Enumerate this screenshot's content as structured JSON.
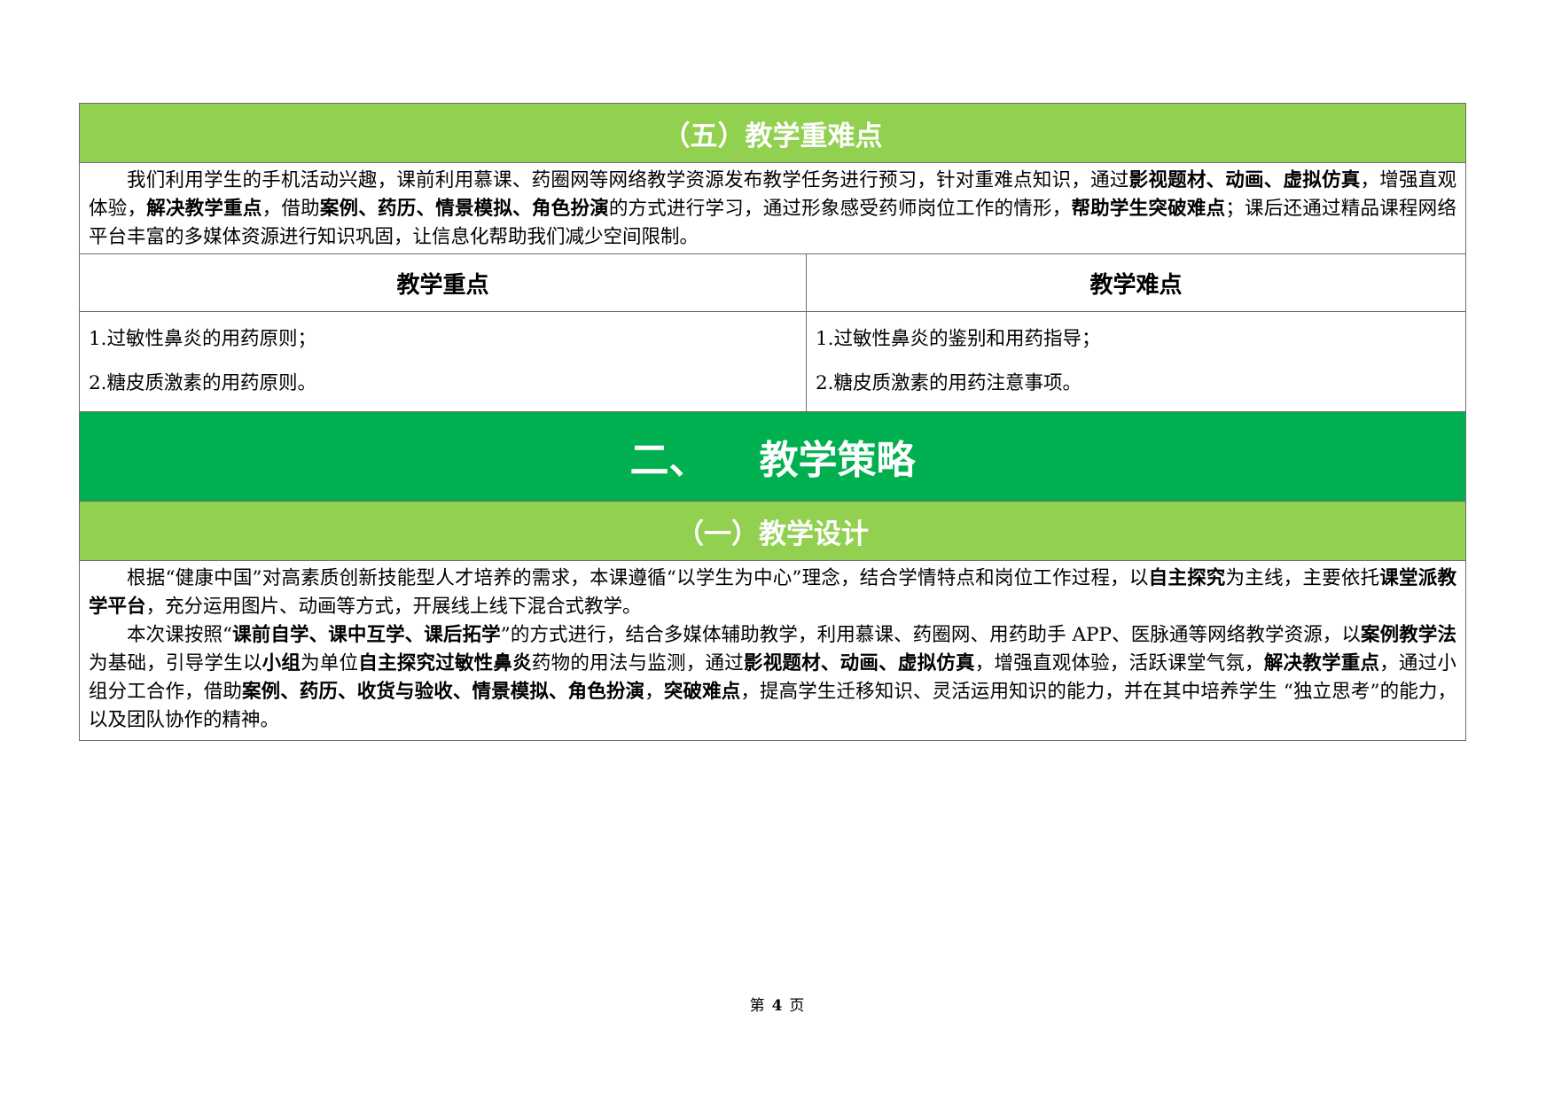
{
  "section5": {
    "title": "（五）教学重难点",
    "intro_runs": [
      {
        "t": "我们利用学生的手机活动兴趣，课前利用慕课、药圈网等网络教学资源发布教学任务进行预习，针对重难点知识，通过",
        "b": false
      },
      {
        "t": "影视题材、动画、虚拟仿真",
        "b": true
      },
      {
        "t": "，增强直观体验，",
        "b": false
      },
      {
        "t": "解决教学重点",
        "b": true
      },
      {
        "t": "，借助",
        "b": false
      },
      {
        "t": "案例、药历、情景模拟、角色扮演",
        "b": true
      },
      {
        "t": "的方式进行学习，通过形象感受药师岗位工作的情形，",
        "b": false
      },
      {
        "t": "帮助学生突破难点",
        "b": true
      },
      {
        "t": "；课后还通过精品课程网络平台丰富的多媒体资源进行知识巩固，让信息化帮助我们减少空间限制。",
        "b": false
      }
    ],
    "key_points": {
      "header": "教学重点",
      "items": [
        "1.过敏性鼻炎的用药原则；",
        "2.糖皮质激素的用药原则。"
      ]
    },
    "difficult_points": {
      "header": "教学难点",
      "items": [
        "1.过敏性鼻炎的鉴别和用药指导；",
        "2.糖皮质激素的用药注意事项。"
      ]
    }
  },
  "chapter2": {
    "number": "二、",
    "title": "教学策略"
  },
  "section1": {
    "title": "（一）教学设计",
    "paragraphs": [
      [
        {
          "t": "根据“健康中国”对高素质创新技能型人才培养的需求，本课遵循“以学生为中心”理念，结合学情特点和岗位工作过程，以",
          "b": false
        },
        {
          "t": "自主探究",
          "b": true
        },
        {
          "t": "为主线，主要依托",
          "b": false
        },
        {
          "t": "课堂派教学平台",
          "b": true
        },
        {
          "t": "，充分运用图片、动画等方式，开展线上线下混合式教学。",
          "b": false
        }
      ],
      [
        {
          "t": "本次课按照“",
          "b": false
        },
        {
          "t": "课前自学、课中互学、课后拓学",
          "b": true
        },
        {
          "t": "”的方式进行，结合多媒体辅助教学，利用慕课、药圈网、用药助手 APP、医脉通等网络教学资源，以",
          "b": false
        },
        {
          "t": "案例教学法",
          "b": true
        },
        {
          "t": "为基础，引导学生以",
          "b": false
        },
        {
          "t": "小组",
          "b": true
        },
        {
          "t": "为单位",
          "b": false
        },
        {
          "t": "自主探究过敏性鼻炎",
          "b": true
        },
        {
          "t": "药物的用法与监测，通过",
          "b": false
        },
        {
          "t": "影视题材、动画、虚拟仿真",
          "b": true
        },
        {
          "t": "，增强直观体验，活跃课堂气氛，",
          "b": false
        },
        {
          "t": "解决教学重点",
          "b": true
        },
        {
          "t": "，通过小组分工合作，借助",
          "b": false
        },
        {
          "t": "案例、药历、收货与验收、情景模拟、角色扮演",
          "b": true
        },
        {
          "t": "，",
          "b": false
        },
        {
          "t": "突破难点",
          "b": true
        },
        {
          "t": "，提高学生迁移知识、灵活运用知识的能力，并在其中培养学生 “独立思考”的能力，以及团队协作的精神。",
          "b": false
        }
      ]
    ]
  },
  "footer": {
    "prefix": "第",
    "page_number": "4",
    "suffix": "页"
  }
}
